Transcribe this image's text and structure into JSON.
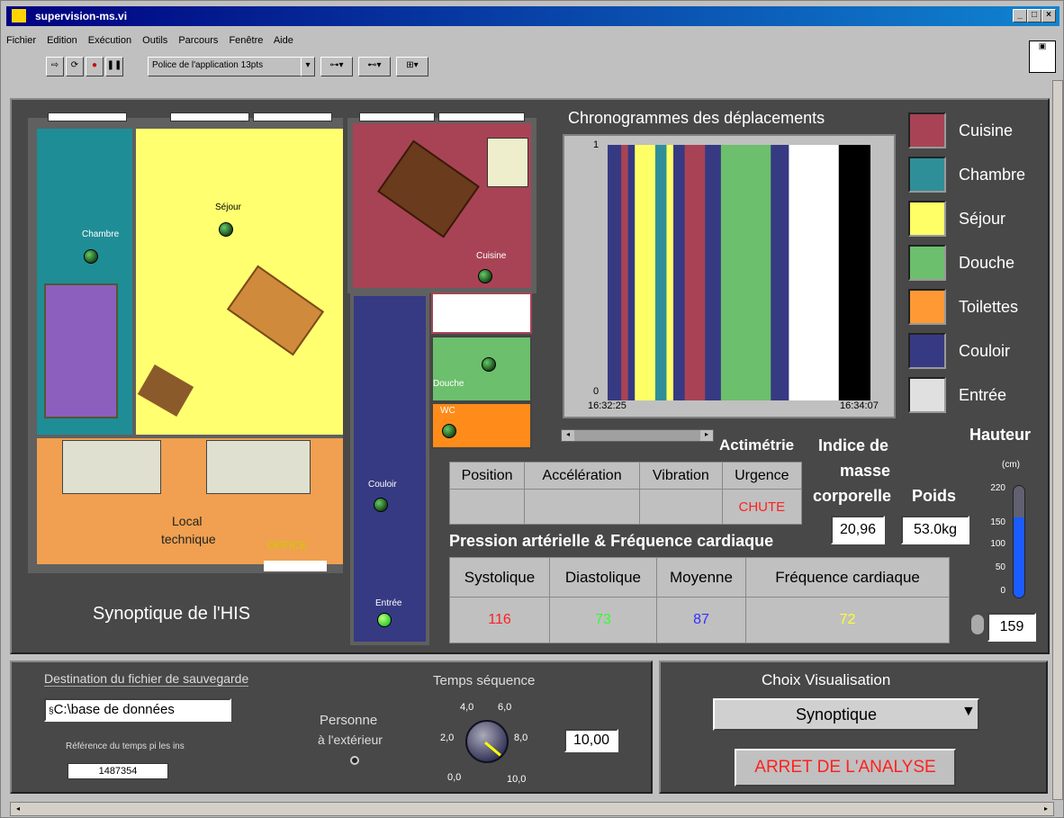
{
  "window": {
    "title": "supervision-ms.vi",
    "btn_min": "_",
    "btn_max": "□",
    "btn_close": "×"
  },
  "menu": [
    "Fichier",
    "Edition",
    "Exécution",
    "Outils",
    "Parcours",
    "Fenêtre",
    "Aide"
  ],
  "toolbar": {
    "font_select": "Police de l'application 13pts"
  },
  "synoptic": {
    "title": "Synoptique de l'HIS",
    "rooms": {
      "chambre": "Chambre",
      "sejour": "Séjour",
      "cuisine": "Cuisine",
      "couloir": "Couloir",
      "douche": "Douche",
      "wc": "WC",
      "entree": "Entrée",
      "local_line1": "Local",
      "local_line2": "technique",
      "office": "OFFICE"
    }
  },
  "chrono": {
    "title": "Chronogrammes des déplacements",
    "y_top": "1",
    "y_bottom": "0",
    "x_start": "16:32:25",
    "x_end": "16:34:07"
  },
  "chart_data": {
    "type": "table",
    "title": "Chronogrammes des déplacements",
    "x": [
      "16:32:25",
      "16:34:07"
    ],
    "ylim": [
      0,
      1
    ],
    "segments": [
      {
        "room": "Couloir",
        "color": "#363a82",
        "w": 3
      },
      {
        "room": "Cuisine",
        "color": "#a84355",
        "w": 1.5
      },
      {
        "room": "Couloir",
        "color": "#363a82",
        "w": 1.5
      },
      {
        "room": "Séjour",
        "color": "#ffff66",
        "w": 4.5
      },
      {
        "room": "Chambre",
        "color": "#2f8f99",
        "w": 2.5
      },
      {
        "room": "Séjour",
        "color": "#ffff66",
        "w": 1.5
      },
      {
        "room": "Couloir",
        "color": "#363a82",
        "w": 2.5
      },
      {
        "room": "Cuisine",
        "color": "#a84355",
        "w": 4.5
      },
      {
        "room": "Couloir",
        "color": "#363a82",
        "w": 3.5
      },
      {
        "room": "Douche",
        "color": "#6cbf6c",
        "w": 11
      },
      {
        "room": "Couloir",
        "color": "#363a82",
        "w": 4
      },
      {
        "room": "Entrée",
        "color": "#ffffff",
        "w": 11
      },
      {
        "room": "Noir",
        "color": "#000000",
        "w": 7
      }
    ]
  },
  "legend": [
    {
      "label": "Cuisine",
      "color": "#a84355"
    },
    {
      "label": "Chambre",
      "color": "#2f8f99"
    },
    {
      "label": "Séjour",
      "color": "#ffff66"
    },
    {
      "label": "Douche",
      "color": "#6cbf6c"
    },
    {
      "label": "Toilettes",
      "color": "#ff9933"
    },
    {
      "label": "Couloir",
      "color": "#363a82"
    },
    {
      "label": "Entrée",
      "color": "#e0e0e0"
    }
  ],
  "actimetry": {
    "title": "Actimétrie",
    "headers": [
      "Position",
      "Accélération",
      "Vibration",
      "Urgence"
    ],
    "values": [
      "",
      "",
      "",
      "CHUTE"
    ]
  },
  "imc": {
    "line1": "Indice de",
    "line2": "masse",
    "line3": "corporelle",
    "value": "20,96"
  },
  "poids": {
    "label": "Poids",
    "value": "53.0kg"
  },
  "hauteur": {
    "label": "Hauteur",
    "unit": "(cm)",
    "ticks": [
      "220",
      "150",
      "100",
      "50",
      "0"
    ],
    "value": "159",
    "level": 0.72
  },
  "pression": {
    "title": "Pression artérielle & Fréquence cardiaque",
    "headers": [
      "Systolique",
      "Diastolique",
      "Moyenne",
      "Fréquence cardiaque"
    ],
    "values": [
      "116",
      "73",
      "87",
      "72"
    ],
    "colors": [
      "#ff2020",
      "#30ff30",
      "#3030ff",
      "#ffff30"
    ]
  },
  "save": {
    "dest_label": "Destination du fichier de sauvegarde",
    "dest_value": "C:\\base de données",
    "ref_label": "Référence du temps pi les ins",
    "ref_value": "1487354"
  },
  "exterior": {
    "line1": "Personne",
    "line2": "à l'extérieur"
  },
  "sequence": {
    "label": "Temps séquence",
    "ticks": [
      "0,0",
      "2,0",
      "4,0",
      "6,0",
      "8,0",
      "10,0"
    ],
    "value": "10,00"
  },
  "visual": {
    "label": "Choix Visualisation",
    "selected": "Synoptique",
    "stop": "ARRET DE L'ANALYSE"
  }
}
